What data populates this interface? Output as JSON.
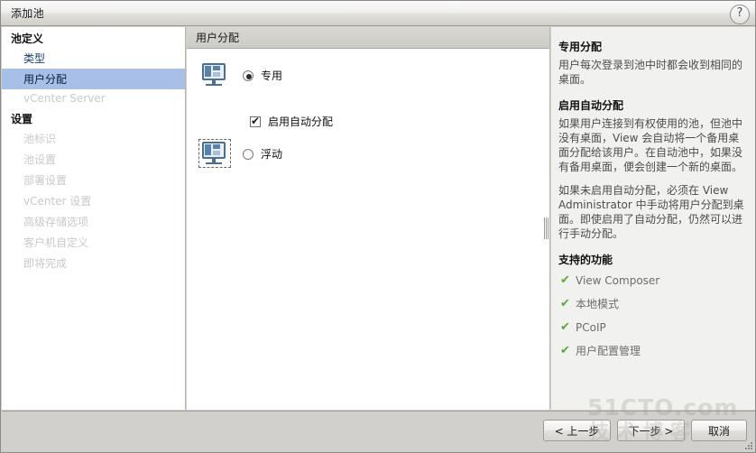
{
  "window": {
    "title": "添加池",
    "help_icon_label": "?"
  },
  "sidebar": {
    "groups": [
      {
        "label": "池定义",
        "items": [
          {
            "label": "类型",
            "state": "enabled"
          },
          {
            "label": "用户分配",
            "state": "selected"
          },
          {
            "label": "vCenter Server",
            "state": "disabled"
          }
        ]
      },
      {
        "label": "设置",
        "items": [
          {
            "label": "池标识",
            "state": "disabled"
          },
          {
            "label": "池设置",
            "state": "disabled"
          },
          {
            "label": "部署设置",
            "state": "disabled"
          },
          {
            "label": "vCenter 设置",
            "state": "disabled"
          },
          {
            "label": "高级存储选项",
            "state": "disabled"
          },
          {
            "label": "客户机自定义",
            "state": "disabled"
          },
          {
            "label": "即将完成",
            "state": "disabled"
          }
        ]
      }
    ]
  },
  "center": {
    "panel_title": "用户分配",
    "option_dedicated": {
      "label": "专用",
      "selected": true,
      "icon": "monitor-icon"
    },
    "checkbox_auto_assign": {
      "label": "启用自动分配",
      "checked": true
    },
    "option_floating": {
      "label": "浮动",
      "selected": false,
      "icon": "monitor-icon",
      "focused": true
    }
  },
  "help": {
    "sections": [
      {
        "heading": "专用分配",
        "paragraphs": [
          "用户每次登录到池中时都会收到相同的桌面。"
        ]
      },
      {
        "heading": "启用自动分配",
        "paragraphs": [
          "如果用户连接到有权使用的池，但池中没有桌面，View 会自动将一个备用桌面分配给该用户。在自动池中，如果没有备用桌面，便会创建一个新的桌面。",
          "如果未启用自动分配，必须在 View Administrator 中手动将用户分配到桌面。即使启用了自动分配，仍然可以进行手动分配。"
        ]
      }
    ],
    "features_heading": "支持的功能",
    "features": [
      {
        "check": "✔",
        "label": "View Composer"
      },
      {
        "check": "✔",
        "label": "本地模式"
      },
      {
        "check": "✔",
        "label": "PCoIP"
      },
      {
        "check": "✔",
        "label": "用户配置管理"
      }
    ],
    "check_color": "#5aa83c"
  },
  "footer": {
    "back_label": "< 上一步",
    "next_label": "下一步 >",
    "cancel_label": "取消"
  },
  "watermark": {
    "main": "51CTO.com",
    "sub": "技术博客"
  }
}
